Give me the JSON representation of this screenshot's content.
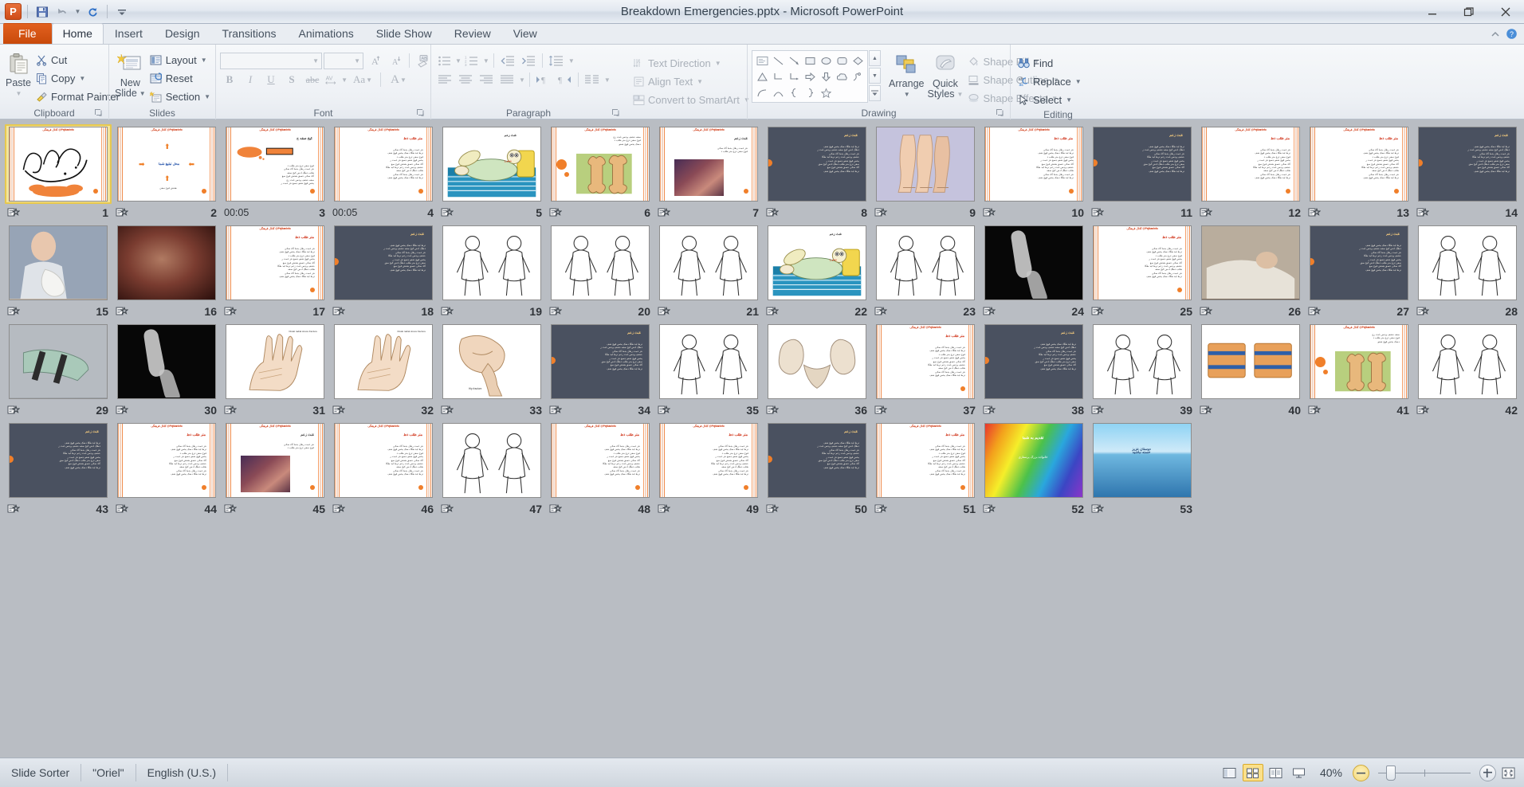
{
  "window": {
    "title": "Breakdown Emergencies.pptx  -  Microsoft PowerPoint",
    "quick_access": [
      {
        "name": "save-icon",
        "label": "Save"
      },
      {
        "name": "undo-icon",
        "label": "Undo"
      },
      {
        "name": "redo-icon",
        "label": "Redo"
      },
      {
        "name": "customize-qat-icon",
        "label": "Customize Quick Access Toolbar"
      }
    ],
    "controls": [
      {
        "name": "minimize-button",
        "label": "Minimize"
      },
      {
        "name": "restore-button",
        "label": "Restore Down"
      },
      {
        "name": "close-button",
        "label": "Close"
      }
    ]
  },
  "tabs": [
    {
      "label": "File",
      "id": "file"
    },
    {
      "label": "Home",
      "id": "home"
    },
    {
      "label": "Insert",
      "id": "insert"
    },
    {
      "label": "Design",
      "id": "design"
    },
    {
      "label": "Transitions",
      "id": "transitions"
    },
    {
      "label": "Animations",
      "id": "animations"
    },
    {
      "label": "Slide Show",
      "id": "slideshow"
    },
    {
      "label": "Review",
      "id": "review"
    },
    {
      "label": "View",
      "id": "view"
    }
  ],
  "tab_right": [
    {
      "name": "minimize-ribbon-icon",
      "label": "Minimize the Ribbon"
    },
    {
      "name": "help-icon",
      "label": "Microsoft PowerPoint Help"
    }
  ],
  "ribbon": {
    "groups": [
      {
        "id": "clipboard",
        "label": "Clipboard",
        "dialog_launcher": true
      },
      {
        "id": "slides",
        "label": "Slides",
        "dialog_launcher": false
      },
      {
        "id": "font",
        "label": "Font",
        "dialog_launcher": true
      },
      {
        "id": "paragraph",
        "label": "Paragraph",
        "dialog_launcher": true
      },
      {
        "id": "drawing",
        "label": "Drawing",
        "dialog_launcher": true
      },
      {
        "id": "editing",
        "label": "Editing",
        "dialog_launcher": false
      }
    ],
    "clipboard": {
      "paste": "Paste",
      "cut": "Cut",
      "copy": "Copy",
      "format_painter": "Format Painter"
    },
    "slides": {
      "new_slide_line1": "New",
      "new_slide_line2": "Slide",
      "layout": "Layout",
      "reset": "Reset",
      "section": "Section"
    },
    "font": {
      "font_name_value": "",
      "font_size_value": "",
      "buttons": [
        {
          "name": "bold-button",
          "label": "B"
        },
        {
          "name": "italic-button",
          "label": "I"
        },
        {
          "name": "underline-button",
          "label": "U"
        },
        {
          "name": "text-shadow-button",
          "label": "S"
        },
        {
          "name": "strikethrough-button",
          "label": "abc"
        },
        {
          "name": "character-spacing-button",
          "label": "AV"
        },
        {
          "name": "change-case-button",
          "label": "Aa"
        },
        {
          "name": "font-color-button",
          "label": "A"
        },
        {
          "name": "grow-font-button",
          "label": "A"
        },
        {
          "name": "shrink-font-button",
          "label": "A"
        },
        {
          "name": "clear-formatting-button",
          "label": "Aa"
        }
      ]
    },
    "paragraph": {
      "text_direction": "Text Direction",
      "align_text": "Align Text",
      "convert_to_smartart": "Convert to SmartArt"
    },
    "drawing": {
      "arrange_label": "Arrange",
      "quick_styles_line1": "Quick",
      "quick_styles_line2": "Styles",
      "shape_fill": "Shape Fill",
      "shape_outline": "Shape Outline",
      "shape_effects": "Shape Effects"
    },
    "editing": {
      "find": "Find",
      "replace": "Replace",
      "select": "Select"
    }
  },
  "statusbar": {
    "view_name": "Slide Sorter",
    "theme": "\"Oriel\"",
    "language": "English (U.S.)",
    "zoom_level": "40%",
    "views": [
      {
        "name": "normal-view-button",
        "label": "Normal",
        "active": false
      },
      {
        "name": "slide-sorter-view-button",
        "label": "Slide Sorter",
        "active": true
      },
      {
        "name": "reading-view-button",
        "label": "Reading View",
        "active": false
      },
      {
        "name": "slide-show-button",
        "label": "Slide Show",
        "active": false
      }
    ],
    "zoom_out_label": "Zoom Out",
    "zoom_in_label": "Zoom In",
    "fit_label": "Fit slide to current window"
  },
  "sorter": {
    "selected_slide": 1,
    "total_slides": 53,
    "slides": [
      {
        "n": 1,
        "timing": "",
        "transition": true,
        "style": "title-bism",
        "sel": true
      },
      {
        "n": 2,
        "timing": "",
        "transition": true,
        "style": "ad-arrows"
      },
      {
        "n": 3,
        "timing": "00:05",
        "transition": false,
        "style": "text-callout"
      },
      {
        "n": 4,
        "timing": "00:05",
        "transition": false,
        "style": "text-page"
      },
      {
        "n": 5,
        "timing": "",
        "transition": true,
        "style": "cartoon-bed"
      },
      {
        "n": 6,
        "timing": "",
        "transition": true,
        "style": "bone-illu"
      },
      {
        "n": 7,
        "timing": "",
        "transition": true,
        "style": "wound-photo"
      },
      {
        "n": 8,
        "timing": "",
        "transition": true,
        "style": "dark-text"
      },
      {
        "n": 9,
        "timing": "",
        "transition": true,
        "style": "legs-illu"
      },
      {
        "n": 10,
        "timing": "",
        "transition": true,
        "style": "text-page"
      },
      {
        "n": 11,
        "timing": "",
        "transition": true,
        "style": "dark-text"
      },
      {
        "n": 12,
        "timing": "",
        "transition": true,
        "style": "text-page"
      },
      {
        "n": 13,
        "timing": "",
        "transition": true,
        "style": "text-page"
      },
      {
        "n": 14,
        "timing": "",
        "transition": true,
        "style": "dark-text"
      },
      {
        "n": 15,
        "timing": "",
        "transition": true,
        "style": "photo-cast"
      },
      {
        "n": 16,
        "timing": "",
        "transition": true,
        "style": "photo-dark"
      },
      {
        "n": 17,
        "timing": "",
        "transition": true,
        "style": "text-page"
      },
      {
        "n": 18,
        "timing": "",
        "transition": true,
        "style": "dark-text"
      },
      {
        "n": 19,
        "timing": "",
        "transition": true,
        "style": "line-art"
      },
      {
        "n": 20,
        "timing": "",
        "transition": true,
        "style": "line-art"
      },
      {
        "n": 21,
        "timing": "",
        "transition": true,
        "style": "line-art"
      },
      {
        "n": 22,
        "timing": "",
        "transition": true,
        "style": "cartoon-bed"
      },
      {
        "n": 23,
        "timing": "",
        "transition": true,
        "style": "line-art"
      },
      {
        "n": 24,
        "timing": "",
        "transition": true,
        "style": "xray"
      },
      {
        "n": 25,
        "timing": "",
        "transition": true,
        "style": "text-page"
      },
      {
        "n": 26,
        "timing": "",
        "transition": true,
        "style": "photo-person"
      },
      {
        "n": 27,
        "timing": "",
        "transition": true,
        "style": "dark-text"
      },
      {
        "n": 28,
        "timing": "",
        "transition": true,
        "style": "line-art"
      },
      {
        "n": 29,
        "timing": "",
        "transition": true,
        "style": "photo-splint"
      },
      {
        "n": 30,
        "timing": "",
        "transition": true,
        "style": "xray"
      },
      {
        "n": 31,
        "timing": "",
        "transition": true,
        "style": "hand-illu"
      },
      {
        "n": 32,
        "timing": "",
        "transition": true,
        "style": "hand-illu"
      },
      {
        "n": 33,
        "timing": "",
        "transition": true,
        "style": "hip-illu"
      },
      {
        "n": 34,
        "timing": "",
        "transition": true,
        "style": "dark-text"
      },
      {
        "n": 35,
        "timing": "",
        "transition": true,
        "style": "line-art"
      },
      {
        "n": 36,
        "timing": "",
        "transition": true,
        "style": "pelvis"
      },
      {
        "n": 37,
        "timing": "",
        "transition": true,
        "style": "text-page"
      },
      {
        "n": 38,
        "timing": "",
        "transition": true,
        "style": "dark-text"
      },
      {
        "n": 39,
        "timing": "",
        "transition": true,
        "style": "line-art"
      },
      {
        "n": 40,
        "timing": "",
        "transition": true,
        "style": "splint-photo"
      },
      {
        "n": 41,
        "timing": "",
        "transition": true,
        "style": "bone-illu"
      },
      {
        "n": 42,
        "timing": "",
        "transition": true,
        "style": "line-art"
      },
      {
        "n": 43,
        "timing": "",
        "transition": true,
        "style": "dark-text"
      },
      {
        "n": 44,
        "timing": "",
        "transition": true,
        "style": "text-page"
      },
      {
        "n": 45,
        "timing": "",
        "transition": true,
        "style": "wound-photo"
      },
      {
        "n": 46,
        "timing": "",
        "transition": true,
        "style": "text-page"
      },
      {
        "n": 47,
        "timing": "",
        "transition": true,
        "style": "line-art"
      },
      {
        "n": 48,
        "timing": "",
        "transition": true,
        "style": "text-page"
      },
      {
        "n": 49,
        "timing": "",
        "transition": true,
        "style": "text-page"
      },
      {
        "n": 50,
        "timing": "",
        "transition": true,
        "style": "dark-text"
      },
      {
        "n": 51,
        "timing": "",
        "transition": true,
        "style": "text-page"
      },
      {
        "n": 52,
        "timing": "",
        "transition": true,
        "style": "rainbow"
      },
      {
        "n": 53,
        "timing": "",
        "transition": true,
        "style": "seascape"
      }
    ]
  }
}
